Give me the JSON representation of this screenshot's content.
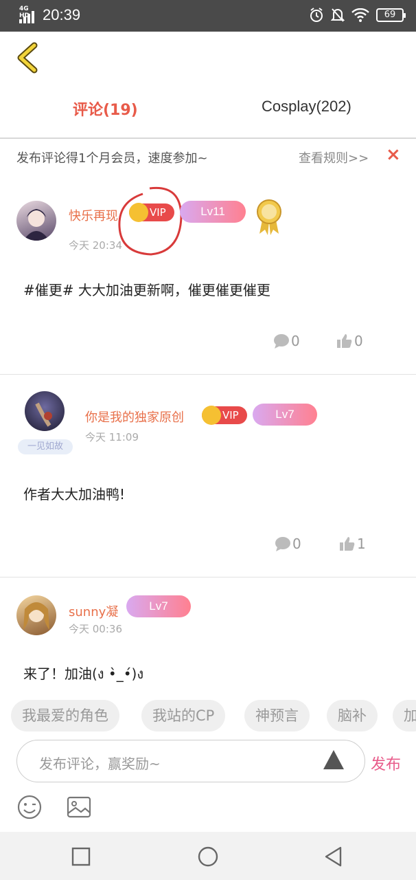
{
  "status_bar": {
    "network": "4G HD",
    "time": "20:39",
    "battery": "69",
    "icons": [
      "alarm-icon",
      "bell-off-icon",
      "wifi-icon",
      "battery-icon"
    ]
  },
  "tabs": [
    {
      "label": "评论(19)",
      "active": true
    },
    {
      "label": "Cosplay(202)",
      "active": false
    }
  ],
  "notice": {
    "text": "发布评论得1个月会员，速度参加~",
    "rule_link": "查看规则>>",
    "close": "×"
  },
  "comments": [
    {
      "username": "快乐再现",
      "vip": "VIP",
      "level": "Lv11",
      "time": "今天 20:34",
      "text": "#催更# 大大加油更新啊，催更催更催更",
      "replies": "0",
      "likes": "0"
    },
    {
      "username": "你是我的独家原创",
      "vip": "VIP",
      "level": "Lv7",
      "time": "今天 11:09",
      "badge": "一见如故",
      "text": "作者大大加油鸭!",
      "replies": "0",
      "likes": "1"
    },
    {
      "username": "sunny凝",
      "level": "Lv7",
      "time": "今天 00:36",
      "text": "来了！加油(ง •̀_•́)ง"
    }
  ],
  "tags": [
    "我最爱的角色",
    "我站的CP",
    "神预言",
    "脑补",
    "加"
  ],
  "input": {
    "placeholder": "发布评论，赢奖励~",
    "publish_label": "发布"
  },
  "colors": {
    "accent": "#e85b4a",
    "vip": "#e84a4a",
    "publish": "#e85b8a"
  }
}
